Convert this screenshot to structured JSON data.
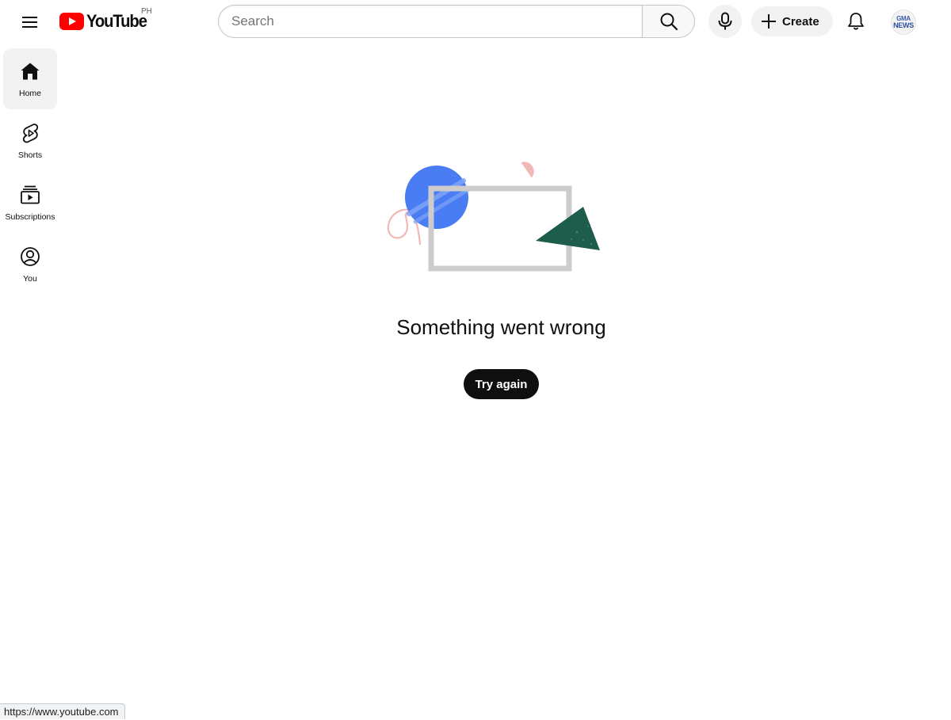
{
  "header": {
    "logo_text": "YouTube",
    "country_code": "PH",
    "search_placeholder": "Search",
    "create_label": "Create",
    "avatar_line1": "GMA",
    "avatar_line2": "NEWS"
  },
  "sidebar": {
    "items": [
      {
        "label": "Home",
        "icon": "home-icon",
        "active": true
      },
      {
        "label": "Shorts",
        "icon": "shorts-icon",
        "active": false
      },
      {
        "label": "Subscriptions",
        "icon": "subscriptions-icon",
        "active": false
      },
      {
        "label": "You",
        "icon": "account-icon",
        "active": false
      }
    ]
  },
  "error": {
    "message": "Something went wrong",
    "retry_label": "Try again"
  },
  "status_bar": {
    "url": "https://www.youtube.com"
  },
  "colors": {
    "brand_red": "#ff0000",
    "illustration_blue": "#4a7cf4",
    "illustration_green": "#1e5c4b",
    "illustration_pink": "#f2b8b5",
    "frame_gray": "#cccccc"
  }
}
